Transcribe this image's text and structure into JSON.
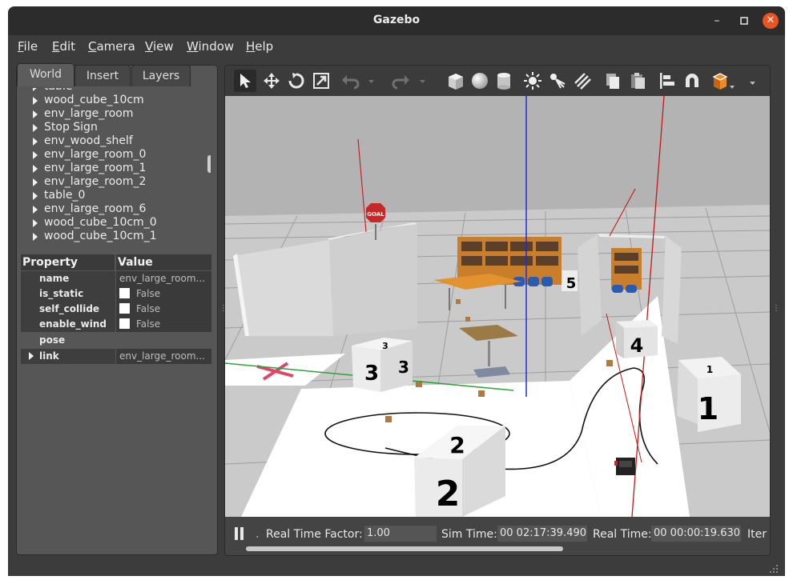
{
  "window": {
    "title": "Gazebo"
  },
  "menu": [
    "File",
    "Edit",
    "Camera",
    "View",
    "Window",
    "Help"
  ],
  "tabs": [
    "World",
    "Insert",
    "Layers"
  ],
  "tree_items": [
    "table",
    "wood_cube_10cm",
    "env_large_room",
    "Stop Sign",
    "env_wood_shelf",
    "env_large_room_0",
    "env_large_room_1",
    "env_large_room_2",
    "table_0",
    "env_large_room_6",
    "wood_cube_10cm_0",
    "wood_cube_10cm_1"
  ],
  "props": {
    "header_property": "Property",
    "header_value": "Value",
    "name_key": "name",
    "name_value": "env_large_room...",
    "is_static_key": "is_static",
    "is_static_value": "False",
    "self_collide_key": "self_collide",
    "self_collide_value": "False",
    "enable_wind_key": "enable_wind",
    "enable_wind_value": "False",
    "pose_key": "pose",
    "link_key": "link",
    "link_value": "env_large_room..."
  },
  "toolbar_icons": [
    "select-arrow-icon",
    "translate-icon",
    "rotate-icon",
    "scale-icon",
    "undo-icon",
    "undo-dropdown-icon",
    "redo-icon",
    "redo-dropdown-icon",
    "box-icon",
    "sphere-icon",
    "cylinder-icon",
    "point-light-icon",
    "spot-light-icon",
    "directional-light-icon",
    "copy-icon",
    "paste-icon",
    "align-icon",
    "snap-icon",
    "view-angle-icon"
  ],
  "scene": {
    "goal_sign": "GOAL",
    "cube_labels": [
      "3",
      "3",
      "3",
      "5",
      "4",
      "1",
      "1",
      "2",
      "2"
    ]
  },
  "status": {
    "rtf_label": "Real Time Factor:",
    "rtf_value": "1.00",
    "sim_label": "Sim Time:",
    "sim_value": "00 02:17:39.490",
    "real_label": "Real Time:",
    "real_value": "00 00:00:19.630",
    "iter_label": "Iter"
  },
  "colors": {
    "accent": "#e95420",
    "panel": "#565656",
    "window": "#3c3c3c"
  }
}
